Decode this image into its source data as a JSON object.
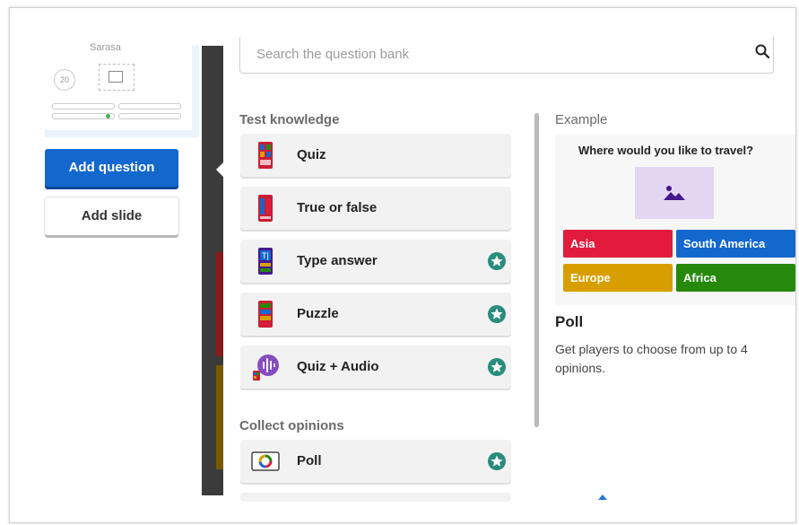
{
  "slide": {
    "title": "Sarasa",
    "timer": "20"
  },
  "sidebar": {
    "add_question_label": "Add question",
    "add_slide_label": "Add slide"
  },
  "search": {
    "placeholder": "Search the question bank"
  },
  "sections": {
    "test_knowledge": "Test knowledge",
    "collect_opinions": "Collect opinions"
  },
  "question_types": [
    {
      "label": "Quiz",
      "icon": "quiz-icon",
      "premium": false
    },
    {
      "label": "True or false",
      "icon": "true-false-icon",
      "premium": false
    },
    {
      "label": "Type answer",
      "icon": "type-answer-icon",
      "premium": true
    },
    {
      "label": "Puzzle",
      "icon": "puzzle-icon",
      "premium": true
    },
    {
      "label": "Quiz + Audio",
      "icon": "quiz-audio-icon",
      "premium": true
    }
  ],
  "opinion_types": [
    {
      "label": "Poll",
      "icon": "poll-icon",
      "premium": true
    }
  ],
  "example": {
    "heading": "Example",
    "question": "Where would you like to travel?",
    "answers": [
      {
        "label": "Asia",
        "color": "#e21b3c"
      },
      {
        "label": "South America",
        "color": "#1368ce"
      },
      {
        "label": "Europe",
        "color": "#d89e00"
      },
      {
        "label": "Africa",
        "color": "#26890c"
      }
    ],
    "title": "Poll",
    "description": "Get players to choose from up to 4 opinions."
  },
  "colors": {
    "primary": "#1368ce",
    "premium_star": "#2a8c7c"
  }
}
